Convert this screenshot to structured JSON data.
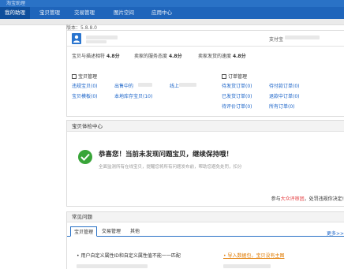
{
  "header": {
    "logo_text": "淘宝助理"
  },
  "nav": {
    "tabs": [
      "我的助理",
      "宝贝管理",
      "交易管理",
      "图片空间",
      "应用中心"
    ]
  },
  "version": "版本：5.8.8.0",
  "profile": {
    "alipay_label": "支付宝",
    "ratings": [
      {
        "label": "宝贝与描述相符",
        "value": "4.8分"
      },
      {
        "label": "卖家的服务态度",
        "value": "4.8分"
      },
      {
        "label": "卖家发货的速度",
        "value": "4.8分"
      }
    ]
  },
  "goods": {
    "title": "宝贝管理",
    "links": [
      "违规宝贝(0)",
      "出售中的",
      "线上",
      "宝贝模板(0)",
      "本地库存宝贝(10)"
    ]
  },
  "orders": {
    "title": "订单管理",
    "links": [
      "待发货订单(0)",
      "待付款订单(0)",
      "已发货订单(0)",
      "退款中订单(0)",
      "待评价订单(0)",
      "所有订单(0)"
    ]
  },
  "health": {
    "title": "宝贝体检中心",
    "congrats": "恭喜您！当前未发现问题宝贝，继续保持哦！",
    "desc": "全面监测所有在线宝贝，提醒您将所有问题发布前，帮助您避免处罚，扣分",
    "footer_prefix": "参与",
    "footer_link": "大众评审团",
    "footer_suffix": "，处罚违规你决定!"
  },
  "faq": {
    "title": "常见问题",
    "tabs": [
      "宝贝管理",
      "交易管理",
      "其他"
    ],
    "more": "更多>>",
    "item1": "用户自定义属性ID和自定义属性值不能一一匹配",
    "item1_link": "导入数据包，宝贝没有主图"
  }
}
